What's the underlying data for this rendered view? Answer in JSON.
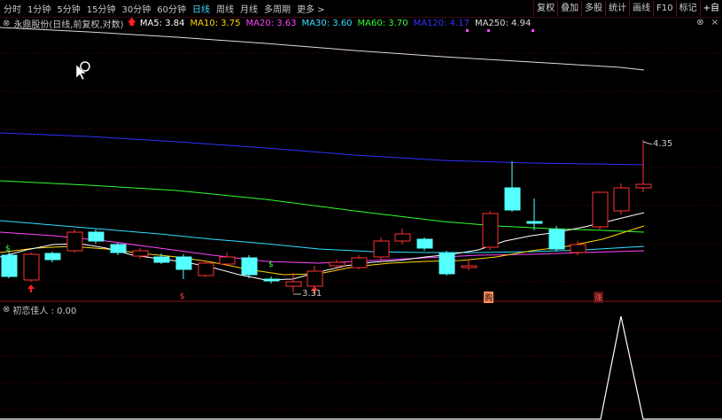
{
  "toolbar": {
    "tabs": [
      "分时",
      "1分钟",
      "5分钟",
      "15分钟",
      "30分钟",
      "60分钟",
      "日线",
      "周线",
      "月线",
      "多周期",
      "更多 >"
    ],
    "active_tab": "日线",
    "tools": [
      "复权",
      "叠加",
      "多股",
      "统计",
      "画线",
      "F10",
      "标记",
      "+自"
    ]
  },
  "main_legend": {
    "title": "永鼎股份(日线,前复权,对数)",
    "ma": [
      {
        "label": "MA5: 3.84",
        "color": "#ffffff"
      },
      {
        "label": "MA10: 3.75",
        "color": "#ffd700"
      },
      {
        "label": "MA20: 3.63",
        "color": "#ff44ff"
      },
      {
        "label": "MA30: 3.60",
        "color": "#33e0ff"
      },
      {
        "label": "MA60: 3.70",
        "color": "#33ff33"
      },
      {
        "label": "MA120: 4.17",
        "color": "#3333ff"
      },
      {
        "label": "MA250: 4.94",
        "color": "#dddddd"
      }
    ]
  },
  "corner": {
    "collapse": "⊗",
    "close": "×"
  },
  "price_labels": {
    "high": "4.35",
    "low": "3.31"
  },
  "signals": {
    "s": "$",
    "b": "购",
    "z": "涨"
  },
  "sub_legend": {
    "label": "初恋佳人 : 0.00"
  },
  "colors": {
    "up": "#ff3232",
    "down": "#54ffff",
    "bg": "#000000",
    "grid": "#5a0a0a"
  }
}
